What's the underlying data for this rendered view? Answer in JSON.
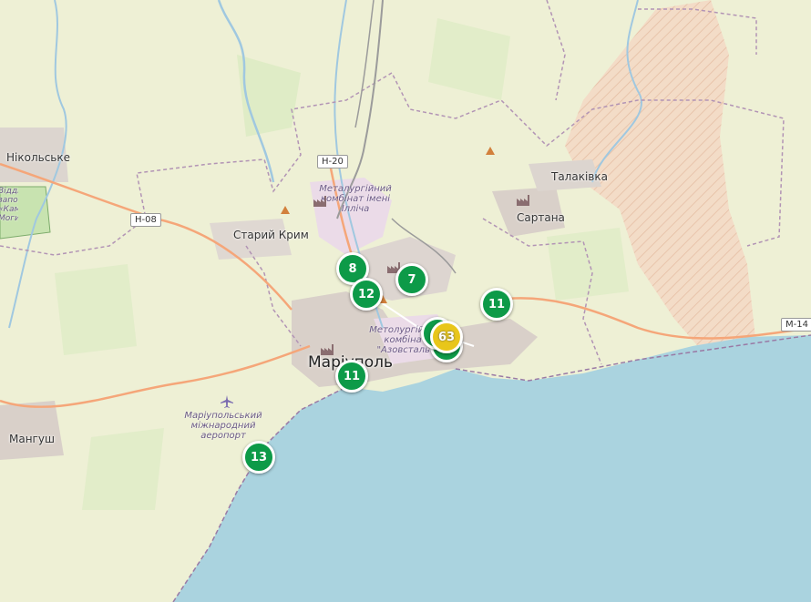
{
  "places": {
    "nikolske": "Нікольське",
    "staryi_krym": "Старий Крим",
    "sartana": "Сартана",
    "talakivka": "Талаківка",
    "mangush": "Мангуш",
    "mariupol": "Маріуполь"
  },
  "poi": {
    "ilyich_plant": "Металургійний комбінат імені Ілліча",
    "azovstal_plant": "Метолургійний комбінат \"Азовсталь\"",
    "airport": "Маріупольський міжнародний аеропорт",
    "reserve": "Відділення заповідника «Кам'яні Могили»"
  },
  "roads": {
    "h20": "Н-20",
    "h08": "Н-08",
    "m14": "М-14"
  },
  "clusters": [
    {
      "count": "8",
      "color": "#0d9a48"
    },
    {
      "count": "12",
      "color": "#0d9a48"
    },
    {
      "count": "7",
      "color": "#0d9a48"
    },
    {
      "count": "11",
      "color": "#0d9a48"
    },
    {
      "count": "63",
      "color": "#e8c61a"
    },
    {
      "count": "11",
      "color": "#0d9a48"
    },
    {
      "count": "13",
      "color": "#0d9a48"
    }
  ],
  "icons": {
    "factory": "factory-icon",
    "airplane": "airplane-icon",
    "peak": "peak-icon"
  },
  "colors": {
    "sea": "#aad3df",
    "land": "#f2efe6",
    "farmland": "#eef0d5",
    "meadow": "#cdebb0",
    "industrial": "#ebdbe8",
    "urban": "#d9d0c9",
    "boundary": "#b294b5",
    "primary_road": "#f5a679",
    "cluster_green": "#0d9a48",
    "cluster_yellow": "#e8c61a"
  }
}
